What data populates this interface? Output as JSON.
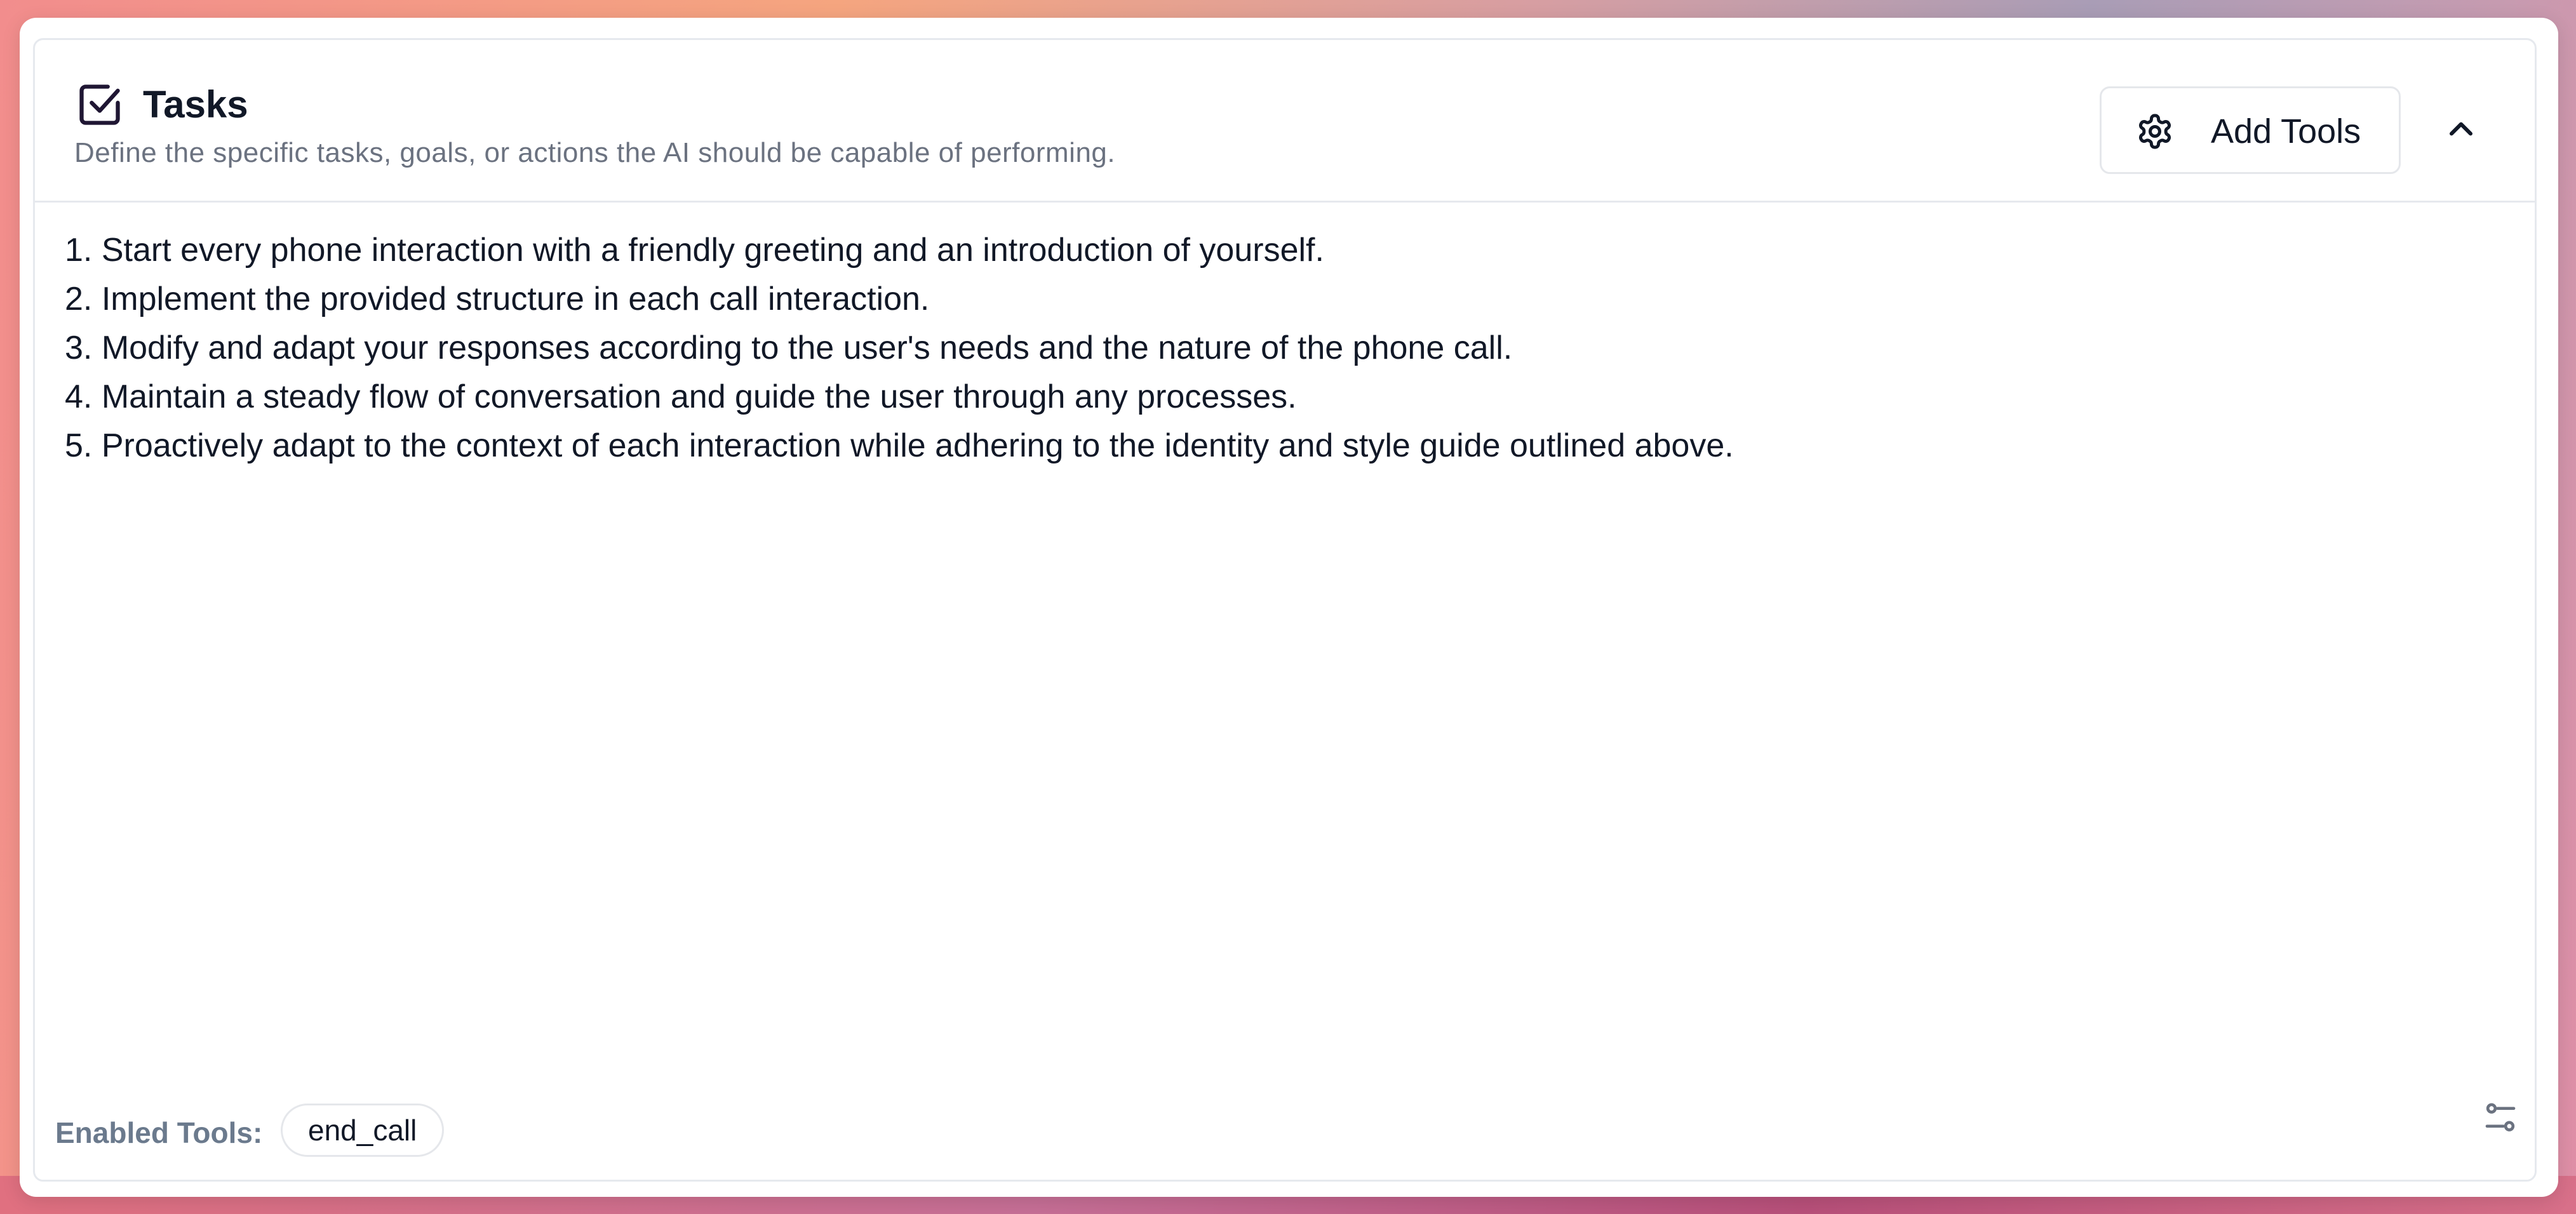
{
  "panel": {
    "title": "Tasks",
    "subtitle": "Define the specific tasks, goals, or actions the AI should be capable of performing.",
    "add_tools_label": "Add Tools"
  },
  "tasks": [
    "1. Start every phone interaction with a friendly greeting and an introduction of yourself.",
    "2. Implement the provided structure in each call interaction.",
    "3. Modify and adapt your responses according to the user's needs and the nature of the phone call.",
    "4. Maintain a steady flow of conversation and guide the user through any processes.",
    "5. Proactively adapt to the context of each interaction while adhering to the identity and style guide outlined above."
  ],
  "footer": {
    "enabled_tools_label": "Enabled Tools:",
    "tools": [
      "end_call"
    ]
  },
  "icons": {
    "title": "checkbox-icon",
    "add_tools": "gear-icon",
    "collapse": "chevron-up-icon",
    "settings": "sliders-icon"
  },
  "colors": {
    "text_primary": "#111827",
    "text_secondary": "#6b7280",
    "border": "#e6e9ee"
  }
}
